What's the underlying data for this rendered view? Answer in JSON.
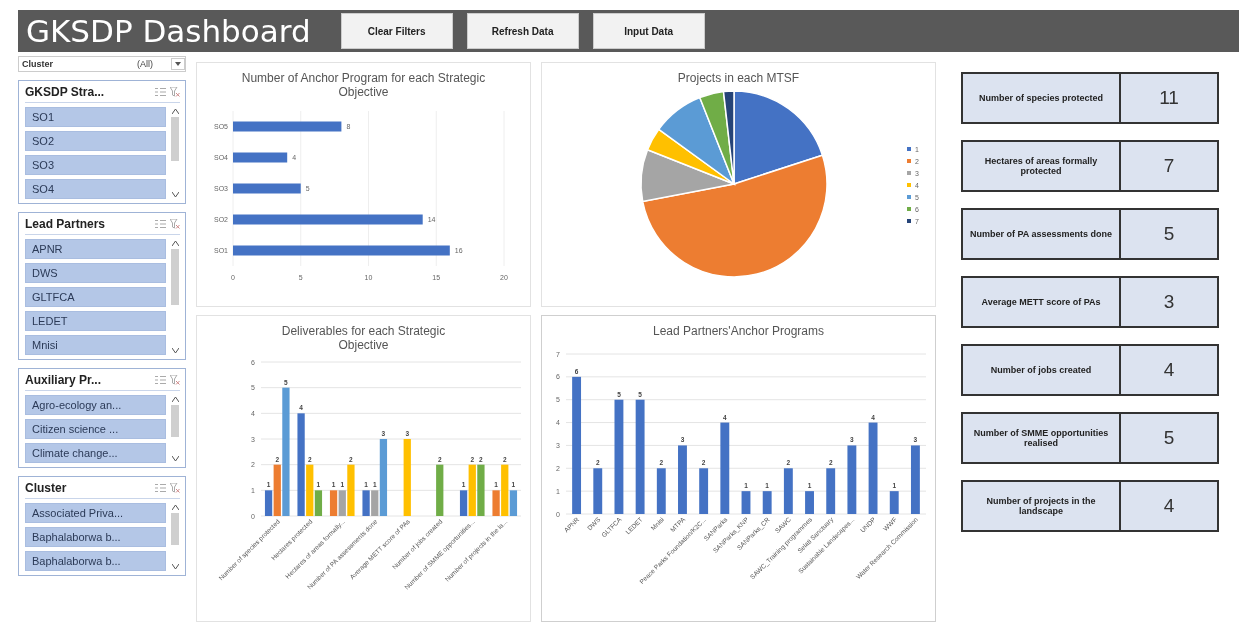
{
  "header": {
    "title": "GKSDP Dashboard",
    "buttons": [
      "Clear Filters",
      "Refresh Data",
      "Input Data"
    ]
  },
  "filter": {
    "label": "Cluster",
    "value": "(All)"
  },
  "slicers": [
    {
      "title": "GKSDP Stra...",
      "items": [
        {
          "label": "SO1",
          "selected": true
        },
        {
          "label": "SO2",
          "selected": true
        },
        {
          "label": "SO3",
          "selected": true
        },
        {
          "label": "SO4",
          "selected": true
        }
      ]
    },
    {
      "title": "Lead Partners",
      "items": [
        {
          "label": "APNR",
          "selected": true
        },
        {
          "label": "DWS",
          "selected": true
        },
        {
          "label": "GLTFCA",
          "selected": true
        },
        {
          "label": "LEDET",
          "selected": true
        },
        {
          "label": "Mnisi",
          "selected": true
        }
      ]
    },
    {
      "title": "Auxiliary Pr...",
      "items": [
        {
          "label": "Agro-ecology an...",
          "selected": true
        },
        {
          "label": "Citizen science ...",
          "selected": true
        },
        {
          "label": "Climate change...",
          "selected": true
        }
      ]
    },
    {
      "title": "Cluster",
      "items": [
        {
          "label": "Associated Priva...",
          "selected": true
        },
        {
          "label": "Baphalaborwa b...",
          "selected": true
        },
        {
          "label": "Baphalaborwa b...",
          "selected": true
        }
      ]
    }
  ],
  "anchor_chart": {
    "chart_data": {
      "type": "bar",
      "orientation": "horizontal",
      "title": "Number of Anchor Program for each Strategic Objective",
      "categories": [
        "SO5",
        "SO4",
        "SO3",
        "SO2",
        "SO1"
      ],
      "series": [
        {
          "color": "#4472c4",
          "values": [
            8,
            4,
            5,
            14,
            16
          ]
        }
      ],
      "xlim": [
        0,
        20
      ],
      "xticks": [
        0,
        5,
        10,
        15,
        20
      ],
      "grid": true,
      "data_labels": true
    }
  },
  "mtsf_chart": {
    "title": "Projects in each MTSF",
    "legend": [
      {
        "label": "1",
        "color": "#4472c4"
      },
      {
        "label": "2",
        "color": "#ed7d31"
      },
      {
        "label": "3",
        "color": "#a5a5a5"
      },
      {
        "label": "4",
        "color": "#ffc000"
      },
      {
        "label": "5",
        "color": "#5b9bd5"
      },
      {
        "label": "6",
        "color": "#70ad47"
      },
      {
        "label": "7",
        "color": "#264478"
      }
    ]
  },
  "deliverables_chart": {
    "chart_data": {
      "type": "bar",
      "title": "Deliverables for each Strategic Objective",
      "categories": [
        "Number of species protected",
        "Hectares protected",
        "Hectares of areas formally...",
        "Number of PA assessments done",
        "Average METT score of PAs",
        "Number of jobs created",
        "Number of SMME opportunities...",
        "Number of projects in the la..."
      ],
      "series": [
        {
          "color": "#4472c4",
          "values": [
            1,
            4,
            null,
            1,
            null,
            null,
            1,
            null
          ]
        },
        {
          "color": "#ed7d31",
          "values": [
            2,
            null,
            1,
            null,
            null,
            null,
            null,
            1
          ]
        },
        {
          "color": "#a5a5a5",
          "values": [
            null,
            null,
            1,
            1,
            null,
            null,
            null,
            null
          ]
        },
        {
          "color": "#ffc000",
          "values": [
            null,
            2,
            2,
            null,
            3,
            null,
            2,
            2
          ]
        },
        {
          "color": "#70ad47",
          "values": [
            null,
            1,
            null,
            null,
            null,
            2,
            2,
            null
          ]
        },
        {
          "color": "#5b9bd5",
          "values": [
            5,
            null,
            null,
            3,
            null,
            null,
            null,
            1
          ]
        }
      ],
      "ylim": [
        0,
        6
      ],
      "yticks": [
        0,
        1,
        2,
        3,
        4,
        5,
        6
      ],
      "grid": true,
      "data_labels": true
    }
  },
  "partners_chart": {
    "chart_data": {
      "type": "bar",
      "title": "Lead Partners'Anchor Programs",
      "categories": [
        "APNR",
        "DWS",
        "GLTFCA",
        "LEDET",
        "Mnisi",
        "MTPA",
        "Peace Parks Foundation/K2C...",
        "SANParks",
        "SANParks_KNP",
        "SANParks_CR",
        "SAWC",
        "SAWC_Training programmes",
        "Selati Sanctuary",
        "Sustainable Landscapes...",
        "UNDP",
        "WWF",
        "Water Research Commission"
      ],
      "series": [
        {
          "color": "#4472c4",
          "values": [
            6,
            2,
            5,
            5,
            2,
            3,
            2,
            4,
            1,
            1,
            2,
            1,
            2,
            3,
            4,
            1,
            3
          ]
        }
      ],
      "ylim": [
        0,
        7
      ],
      "yticks": [
        0,
        1,
        2,
        3,
        4,
        5,
        6,
        7
      ],
      "grid": true,
      "data_labels": true
    }
  },
  "kpis": [
    {
      "label": "Number of species protected",
      "value": "11"
    },
    {
      "label": "Hectares of areas formally protected",
      "value": "7"
    },
    {
      "label": "Number of PA assessments done",
      "value": "5"
    },
    {
      "label": "Average METT score of PAs",
      "value": "3"
    },
    {
      "label": "Number of jobs created",
      "value": "4"
    },
    {
      "label": "Number of SMME opportunities realised",
      "value": "5"
    },
    {
      "label": "Number of projects in the landscape",
      "value": "4"
    }
  ]
}
